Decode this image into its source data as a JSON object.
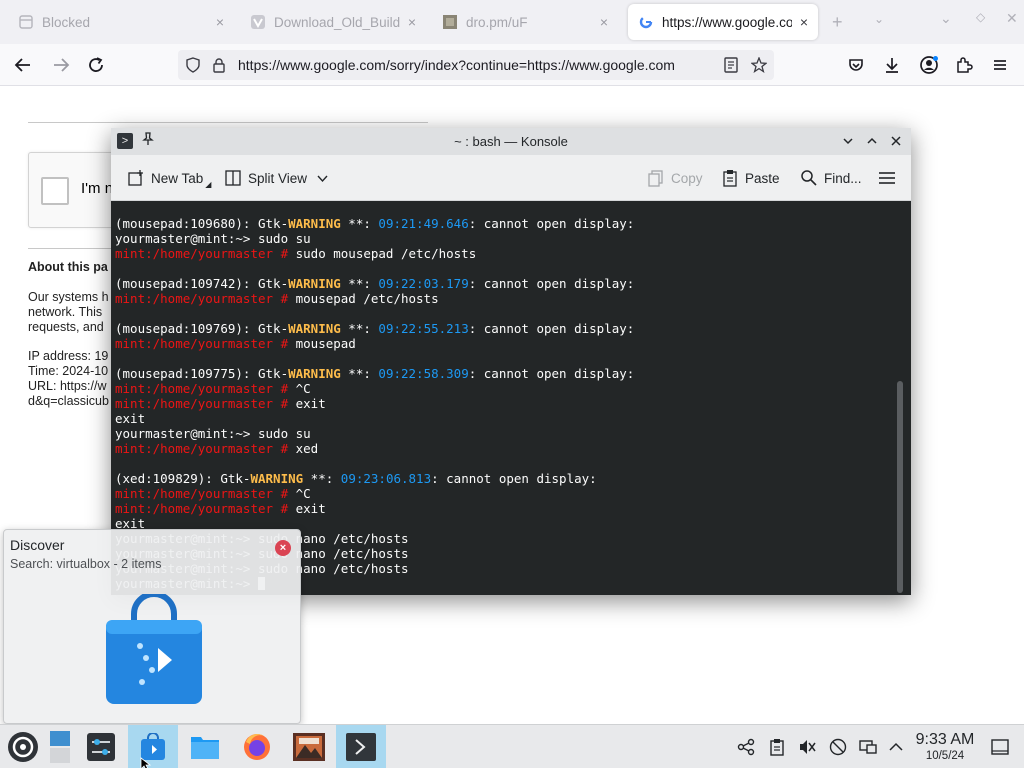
{
  "browser": {
    "tabs": [
      {
        "label": "Blocked",
        "close": "×"
      },
      {
        "label": "Download_Old_Builds",
        "close": "×"
      },
      {
        "label": "dro.pm/uF",
        "close": "×"
      },
      {
        "label": "https://www.google.com",
        "close": "×"
      }
    ],
    "new_tab_label": "+",
    "url": "https://www.google.com/sorry/index?continue=https://www.google.com"
  },
  "page": {
    "captcha_text": "I'm n",
    "about_heading": "About this pa",
    "body_lines": [
      "Our systems h",
      "network. This",
      "requests, and",
      "",
      "IP address: 19",
      "Time: 2024-10",
      "URL: https://w",
      "d&q=classicub"
    ]
  },
  "konsole": {
    "title": "~ : bash — Konsole",
    "toolbar": {
      "new_tab": "New Tab",
      "split_view": "Split View",
      "copy": "Copy",
      "paste": "Paste",
      "find": "Find..."
    }
  },
  "terminal": {
    "lines": [
      [
        {
          "t": "(mousepad:109680): Gtk-"
        },
        {
          "t": "WARNING",
          "c": "y"
        },
        {
          "t": " **: "
        },
        {
          "t": "09:21:49.646",
          "c": "b"
        },
        {
          "t": ": cannot open display:"
        }
      ],
      [
        {
          "t": "yourmaster@mint:~> sudo su"
        }
      ],
      [
        {
          "t": "mint:/home/yourmaster #",
          "c": "r"
        },
        {
          "t": " sudo mousepad /etc/hosts"
        }
      ],
      [],
      [
        {
          "t": "(mousepad:109742): Gtk-"
        },
        {
          "t": "WARNING",
          "c": "y"
        },
        {
          "t": " **: "
        },
        {
          "t": "09:22:03.179",
          "c": "b"
        },
        {
          "t": ": cannot open display:"
        }
      ],
      [
        {
          "t": "mint:/home/yourmaster #",
          "c": "r"
        },
        {
          "t": " mousepad /etc/hosts"
        }
      ],
      [],
      [
        {
          "t": "(mousepad:109769): Gtk-"
        },
        {
          "t": "WARNING",
          "c": "y"
        },
        {
          "t": " **: "
        },
        {
          "t": "09:22:55.213",
          "c": "b"
        },
        {
          "t": ": cannot open display:"
        }
      ],
      [
        {
          "t": "mint:/home/yourmaster #",
          "c": "r"
        },
        {
          "t": " mousepad"
        }
      ],
      [],
      [
        {
          "t": "(mousepad:109775): Gtk-"
        },
        {
          "t": "WARNING",
          "c": "y"
        },
        {
          "t": " **: "
        },
        {
          "t": "09:22:58.309",
          "c": "b"
        },
        {
          "t": ": cannot open display:"
        }
      ],
      [
        {
          "t": "mint:/home/yourmaster #",
          "c": "r"
        },
        {
          "t": " ^C"
        }
      ],
      [
        {
          "t": "mint:/home/yourmaster #",
          "c": "r"
        },
        {
          "t": " exit"
        }
      ],
      [
        {
          "t": "exit"
        }
      ],
      [
        {
          "t": "yourmaster@mint:~> sudo su"
        }
      ],
      [
        {
          "t": "mint:/home/yourmaster #",
          "c": "r"
        },
        {
          "t": " xed"
        }
      ],
      [],
      [
        {
          "t": "(xed:109829): Gtk-"
        },
        {
          "t": "WARNING",
          "c": "y"
        },
        {
          "t": " **: "
        },
        {
          "t": "09:23:06.813",
          "c": "b"
        },
        {
          "t": ": cannot open display:"
        }
      ],
      [
        {
          "t": "mint:/home/yourmaster #",
          "c": "r"
        },
        {
          "t": " ^C"
        }
      ],
      [
        {
          "t": "mint:/home/yourmaster #",
          "c": "r"
        },
        {
          "t": " exit"
        }
      ],
      [
        {
          "t": "exit"
        }
      ],
      [
        {
          "t": "yourmaster@mint:~> sudo nano /etc/hosts"
        }
      ],
      [
        {
          "t": "yourmaster@mint:~> sudo nano /etc/hosts"
        }
      ],
      [
        {
          "t": "yourmaster@mint:~> sudo nano /etc/hosts"
        }
      ],
      [
        {
          "t": "yourmaster@mint:~> "
        },
        {
          "cursor": true
        }
      ]
    ]
  },
  "discover": {
    "title": "Discover",
    "subtitle": "Search: virtualbox - 2 items",
    "close": "×"
  },
  "taskbar": {
    "time": "9:33 AM",
    "date": "10/5/24"
  },
  "colors": {
    "terminal_bg": "#232627",
    "prompt_red": "#ed1515",
    "warning_yellow": "#fdbc4b",
    "timestamp_blue": "#1d99f3",
    "taskbar_active": "#a8d8f0"
  }
}
